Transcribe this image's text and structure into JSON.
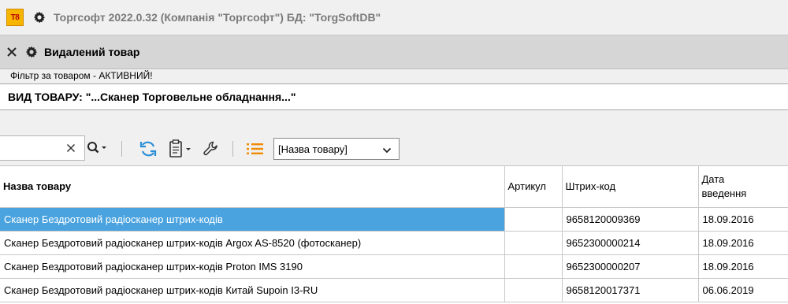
{
  "app": {
    "logo_text": "T8",
    "title": "Торгсофт 2022.0.32 (Компанія \"Торгсофт\") БД: \"TorgSoftDB\""
  },
  "document": {
    "title": "Видалений товар"
  },
  "filter": {
    "label": "Фільтр за товаром - АКТИВНИЙ!",
    "value": "ВИД ТОВАРУ: \"...Сканер Торговельне обладнання...\""
  },
  "toolbar": {
    "search_value": "",
    "sort_selected": "[Назва товару]"
  },
  "table": {
    "columns": [
      "Назва товару",
      "Артикул",
      "Штрих-код",
      "Дата введення"
    ],
    "rows": [
      {
        "name": "Сканер Бездротовий радіосканер штрих-кодів",
        "article": "",
        "barcode": "9658120009369",
        "date": "18.09.2016",
        "selected": true
      },
      {
        "name": "Сканер Бездротовий радіосканер штрих-кодів Argox AS-8520 (фотосканер)",
        "article": "",
        "barcode": "9652300000214",
        "date": "18.09.2016",
        "selected": false
      },
      {
        "name": "Сканер Бездротовий радіосканер штрих-кодів Proton IMS 3190",
        "article": "",
        "barcode": "9652300000207",
        "date": "18.09.2016",
        "selected": false
      },
      {
        "name": "Сканер Бездротовий радіосканер штрих-кодів Китай Supoin I3-RU",
        "article": "",
        "barcode": "9658120017371",
        "date": "06.06.2019",
        "selected": false
      }
    ]
  },
  "colors": {
    "selection": "#4aa3df",
    "accent_blue": "#2b8fd6",
    "accent_orange": "#f08a00"
  }
}
